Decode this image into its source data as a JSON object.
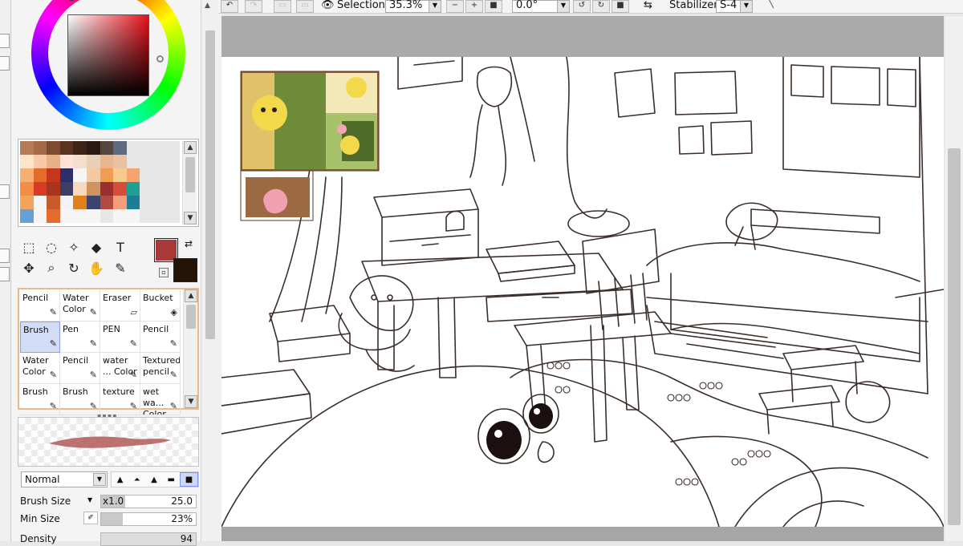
{
  "toolbar": {
    "selection_label": "Selection",
    "zoom_value": "35.3%",
    "rotation_value": "0.0°",
    "stabilizer_label": "Stabilizer",
    "stabilizer_value": "S-4"
  },
  "colors": {
    "foreground": "#a93a3a",
    "background": "#241307",
    "panel_accent": "#e9b98f"
  },
  "swatches": [
    "#b57b57",
    "#a56a4a",
    "#7d4a32",
    "#5b3421",
    "#3e2317",
    "#2a1a12",
    "#54473f",
    "#5e6a80",
    "#e7e7e7",
    "#e7e7e7",
    "#e7e7e7",
    "#e7e7e7",
    "#fbe3cc",
    "#f6caa9",
    "#e7b089",
    "#fde2d5",
    "#f3ded0",
    "#e8d0b6",
    "#e9b58e",
    "#e9c2a2",
    "#e7e7e7",
    "#e7e7e7",
    "#e7e7e7",
    "#e7e7e7",
    "#f6b076",
    "#e46c2b",
    "#c4371c",
    "#2d2d6a",
    "#f5f5f5",
    "#f2c9a3",
    "#ef9d50",
    "#f4cb8d",
    "#f8a36b",
    "#e7e7e7",
    "#e7e7e7",
    "#e7e7e7",
    "#f48c43",
    "#d83a23",
    "#a8341f",
    "#3d3d66",
    "#f8d9bc",
    "#cf9360",
    "#98302f",
    "#d34d3a",
    "#20a094",
    "#e7e7e7",
    "#e7e7e7",
    "#e7e7e7",
    "#f2a45d",
    "#f5f5f5",
    "#c75b2a",
    "#f3f3f3",
    "#e0801c",
    "#3d4470",
    "#b14a40",
    "#f39d7c",
    "#1e7c95",
    "#e7e7e7",
    "#e7e7e7",
    "#e7e7e7",
    "#66a0d8",
    "#f5f5f5",
    "#e46b2b",
    "#f5f5f5",
    "#f5f5f5",
    "#f5f5f5",
    "#e7e7e7",
    "#f5f5f5",
    "#f5f5f5",
    "#e7e7e7",
    "#e7e7e7",
    "#e7e7e7"
  ],
  "tools": [
    {
      "name": "rect-select-icon",
      "glyph": "⬚"
    },
    {
      "name": "lasso-icon",
      "glyph": "◌"
    },
    {
      "name": "magic-wand-icon",
      "glyph": "✧"
    },
    {
      "name": "bucket-fill-icon",
      "glyph": "◆"
    },
    {
      "name": "text-icon",
      "glyph": "T"
    },
    {
      "name": "move-icon",
      "glyph": "✥"
    },
    {
      "name": "zoom-icon",
      "glyph": "⌕"
    },
    {
      "name": "rotate-icon",
      "glyph": "↻"
    },
    {
      "name": "hand-icon",
      "glyph": "✋"
    },
    {
      "name": "eyedropper-icon",
      "glyph": "✎"
    }
  ],
  "brushes": [
    {
      "label": "Pencil",
      "icon": "✎",
      "selected": false
    },
    {
      "label": "Water Color",
      "icon": "✎",
      "selected": false
    },
    {
      "label": "Eraser",
      "icon": "▱",
      "selected": false
    },
    {
      "label": "Bucket",
      "icon": "◈",
      "selected": false
    },
    {
      "label": "Brush",
      "icon": "✎",
      "selected": true
    },
    {
      "label": "Pen",
      "icon": "✎",
      "selected": false
    },
    {
      "label": "PEN",
      "icon": "✎",
      "selected": false
    },
    {
      "label": "Pencil",
      "icon": "✎",
      "selected": false
    },
    {
      "label": "Water Color",
      "icon": "✎",
      "selected": false
    },
    {
      "label": "Pencil",
      "icon": "✎",
      "selected": false
    },
    {
      "label": "water ... Color",
      "icon": "✎",
      "selected": false
    },
    {
      "label": "Textured pencil",
      "icon": "✎",
      "selected": false
    },
    {
      "label": "Brush",
      "icon": "✎",
      "selected": false
    },
    {
      "label": "Brush",
      "icon": "✎",
      "selected": false
    },
    {
      "label": "texture",
      "icon": "✎",
      "selected": false
    },
    {
      "label": "wet wa... Color",
      "icon": "✎",
      "selected": false
    }
  ],
  "blend_mode": "Normal",
  "properties": {
    "brush_size_label": "Brush Size",
    "brush_size_mult": "x1.0",
    "brush_size_value": "25.0",
    "min_size_label": "Min Size",
    "min_size_value": "23%",
    "min_size_fraction": 0.23,
    "density_label": "Density",
    "density_value": "94"
  }
}
